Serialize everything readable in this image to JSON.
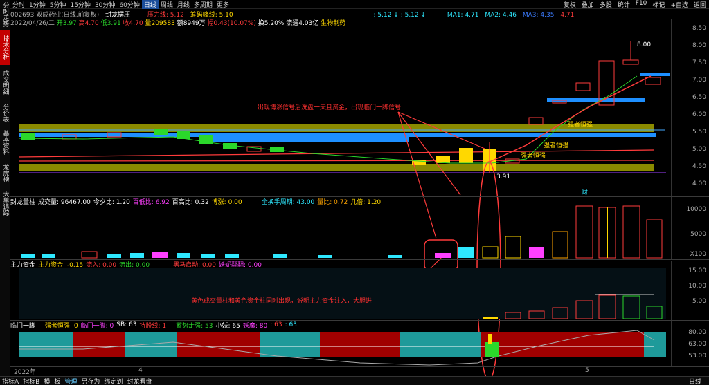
{
  "sidebar_tabs": [
    "分时走势",
    "技术分析",
    "成交明细",
    "分价表",
    "基本资料",
    "龙虎榜",
    "大单追踪"
  ],
  "topbar": {
    "timeframes": [
      "分时",
      "1分钟",
      "5分钟",
      "15分钟",
      "30分钟",
      "60分钟",
      "日线",
      "周线",
      "月线",
      "多周期",
      "更多"
    ],
    "selected_timeframe": "日线",
    "indicator_name": "封龙摆压",
    "right_buttons": [
      "复权",
      "叠加",
      "多股",
      "统计",
      "F10",
      "标记",
      "+自选",
      "返回"
    ]
  },
  "header": {
    "stock": "002693 双成药业(日线,前复权)",
    "pressure_label": "压力线: 5.12",
    "chip_peak_label": "筹码峰线: 5.10",
    "ma_preline": ": 5.12 ↓ : 5.12 ↓",
    "ma1": "MA1: 4.71",
    "ma2": "MA2: 4.46",
    "ma3": "MA3: 4.35",
    "ma4": "4.71",
    "date": "2022/04/26/二",
    "open": "开3.97",
    "high": "高4.70",
    "low": "低3.91",
    "close": "收4.70",
    "volume": "量209583",
    "amount": "额8949万",
    "change": "幅0.43(10.07%)",
    "turnover": "换5.20%",
    "float": "流通4.03亿",
    "sector": "生物制药"
  },
  "price_axis": [
    "8.50",
    "8.00",
    "7.50",
    "7.00",
    "6.50",
    "6.00",
    "5.50",
    "5.00",
    "4.50",
    "4.00"
  ],
  "price_labels": {
    "high_mark": "8.00",
    "low_mark": "3.91"
  },
  "annotations": {
    "top_note": "出现博涨信号后洗盘一天且资金，出现临门一脚信号",
    "strong1": "强者恒强",
    "strong2": "强者恒强",
    "strong3": "强者恒强",
    "middle_note": "黄色成交量柱和黄色资金柱同时出现，说明主力资金注入，大胆进",
    "cai": "财"
  },
  "vol_panel": {
    "title": "封龙量柱",
    "vol": "成交量: 96467.00",
    "today": "今夕比: 1.20",
    "baidi": "百低比: 6.92",
    "baigao": "百高比: 0.32",
    "bozhang": "博涨: 0.00",
    "quanhuan": "全换手周期: 43.00",
    "liangbi": "量比: 0.72",
    "jibei": "几倍: 1.20",
    "axis": [
      "10000",
      "5000"
    ],
    "unit": "X100"
  },
  "fund_panel": {
    "title": "主力资金",
    "fund": "主力资金: -0.15",
    "inflow": "流入: 0.00",
    "outflow": "流出: 0.00",
    "heima": "黑马启动: 0.00",
    "yaoni": "妖妮翻翻: 0.00",
    "axis": [
      "15.00",
      "10.00",
      "5.00"
    ]
  },
  "kick_panel": {
    "title": "临门一脚",
    "strong": "强者恒强: 0",
    "kick": "临门一脚: 0",
    "sb": "SB: 63",
    "hold": "持股线: 1",
    "trend": "蓄势走强: 53",
    "small_demon": "小妖: 65",
    "demon_eye": "妖魔: 80",
    "v1": ": 63",
    "v2": ": 63",
    "axis": [
      "80.00",
      "63.00",
      "53.00"
    ]
  },
  "date_axis": {
    "left": "2022年",
    "mid": "4",
    "right": "5"
  },
  "bottom_bar": [
    "指标A",
    "指标B",
    "模",
    "板",
    "管理",
    "另存为",
    "绑定到",
    "封龙看盘"
  ],
  "bottom_selected": "管理",
  "bottom_right": "日线",
  "colors": {
    "up": "#ff3b3b",
    "down": "#2ee8ff",
    "yellow": "#ffd800",
    "band": "#8a8a00",
    "blue_band": "#1e8fff",
    "teal": "#1e9a9a",
    "maroon": "#a00000"
  }
}
